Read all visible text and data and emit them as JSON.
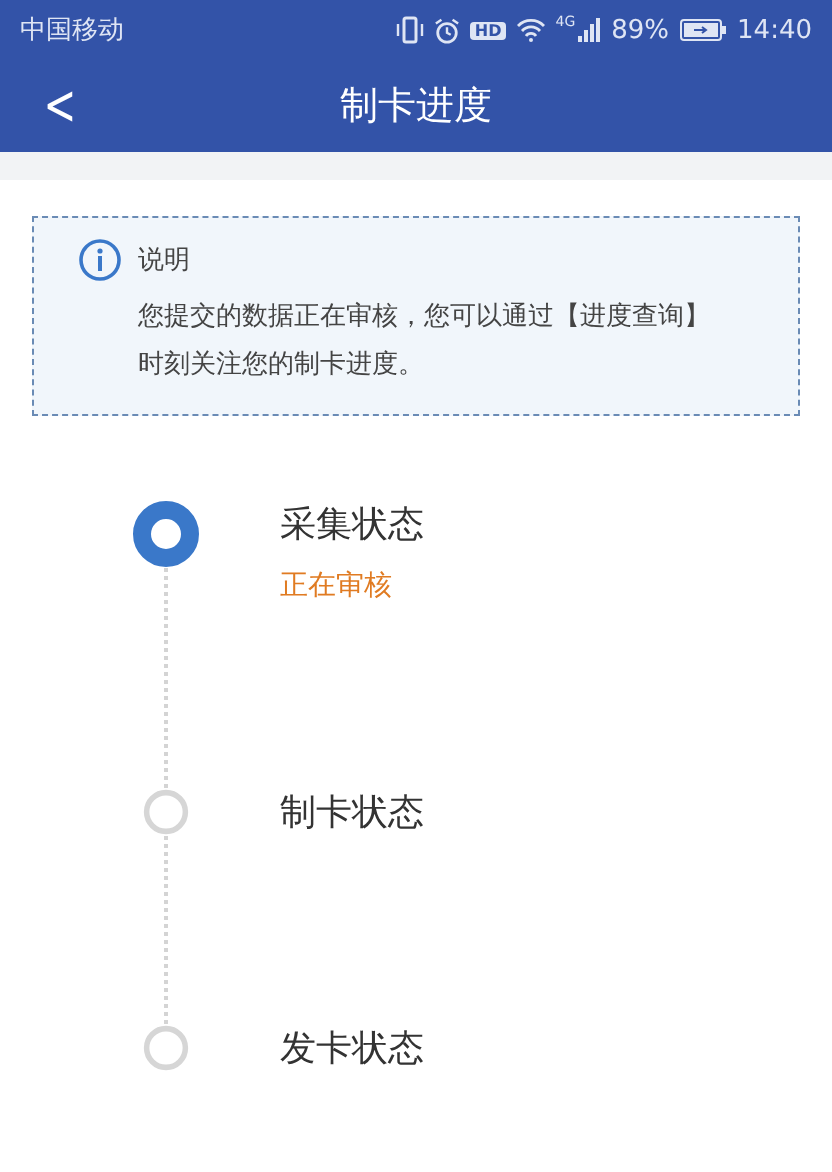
{
  "status_bar": {
    "carrier": "中国移动",
    "hd_badge": "HD",
    "network": "4G",
    "battery": "89%",
    "time": "14:40"
  },
  "header": {
    "back": "<",
    "title": "制卡进度"
  },
  "notice": {
    "title": "说明",
    "text": "您提交的数据正在审核，您可以通过【进度查询】时刻关注您的制卡进度。"
  },
  "steps": [
    {
      "title": "采集状态",
      "status": "正在审核",
      "active": true
    },
    {
      "title": "制卡状态",
      "active": false
    },
    {
      "title": "发卡状态",
      "active": false
    }
  ]
}
